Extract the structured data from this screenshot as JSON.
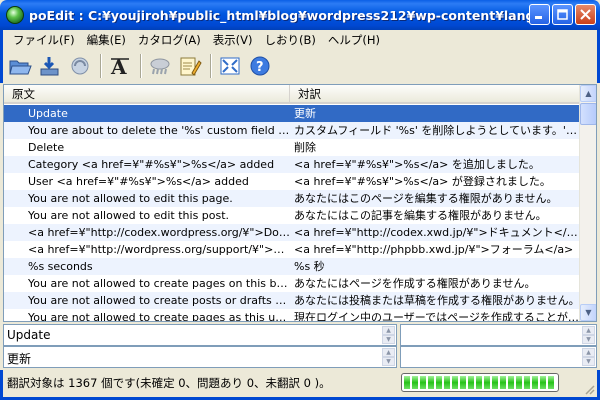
{
  "window": {
    "title": "poEdit : C:¥youjiroh¥public_html¥blog¥wordpress212¥wp-content¥languag...",
    "minimize": "_",
    "maximize": "□",
    "close": "✕"
  },
  "menu": [
    "ファイル(F)",
    "編集(E)",
    "カタログ(A)",
    "表示(V)",
    "しおり(B)",
    "ヘルプ(H)"
  ],
  "toolbar": {
    "icons": [
      "open-folder-icon",
      "save-icon",
      "update-icon",
      "font-icon",
      "validate-icon",
      "comment-icon",
      "fullscreen-icon",
      "help-icon"
    ]
  },
  "list": {
    "columns": [
      "原文",
      "対訳"
    ],
    "selected_index": 0,
    "rows": [
      {
        "source": "Update",
        "translation": "更新"
      },
      {
        "source": "You are about to delete the '%s' custom field on t...",
        "translation": "カスタムフィールド '%s' を削除しようとしています。'OK' で..."
      },
      {
        "source": "Delete",
        "translation": "削除"
      },
      {
        "source": "Category <a href=¥\"#%s¥\">%s</a> added",
        "translation": "<a href=¥\"#%s¥\">%s</a> を追加しました。"
      },
      {
        "source": "User <a href=¥\"#%s¥\">%s</a> added",
        "translation": "<a href=¥\"#%s¥\">%s</a> が登録されました。"
      },
      {
        "source": "You are not allowed to edit this page.",
        "translation": "あなたにはこのページを編集する権限がありません。"
      },
      {
        "source": "You are not allowed to edit this post.",
        "translation": "あなたにはこの記事を編集する権限がありません。"
      },
      {
        "source": "<a href=¥\"http://codex.wordpress.org/¥\">Docum...",
        "translation": "<a href=¥\"http://codex.xwd.jp/¥\">ドキュメント</a>"
      },
      {
        "source": "<a href=¥\"http://wordpress.org/support/¥\">Supp...",
        "translation": "<a href=¥\"http://phpbb.xwd.jp/¥\">フォーラム</a>"
      },
      {
        "source": "%s seconds",
        "translation": "%s 秒"
      },
      {
        "source": "You are not allowed to create pages on this blog.",
        "translation": "あなたにはページを作成する権限がありません。"
      },
      {
        "source": "You are not allowed to create posts or drafts on ...",
        "translation": "あなたには投稿または草稿を作成する権限がありません。"
      },
      {
        "source": "You are not allowed to create pages as this user...",
        "translation": "現在ログイン中のユーザーではページを作成することができ..."
      }
    ]
  },
  "source_pane": {
    "text": "Update"
  },
  "translation_pane": {
    "text": "更新"
  },
  "status": {
    "text": "翻訳対象は 1367 個です(未確定 0、問題あり 0、未翻訳 0 )。",
    "progress_fraction": 1.0
  },
  "colors": {
    "titlebar": "#0048d2",
    "selection": "#316ac5",
    "row_alt": "#edf3fe",
    "progress": "#26c218"
  }
}
